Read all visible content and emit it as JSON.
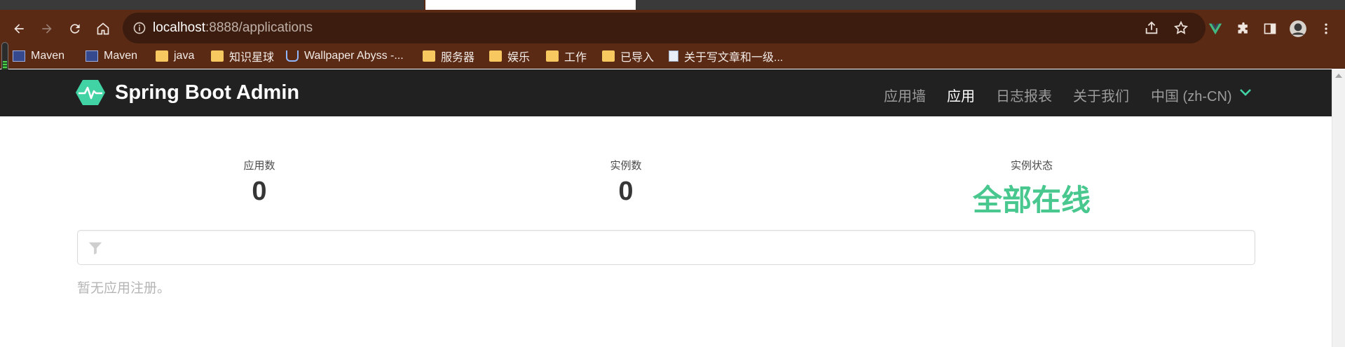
{
  "browser": {
    "url_host": "localhost",
    "url_rest": ":8888/applications",
    "bookmarks": [
      {
        "label": "Maven",
        "icon": "maven-icon"
      },
      {
        "label": "Maven",
        "icon": "maven-icon"
      },
      {
        "label": "java",
        "icon": "folder-icon"
      },
      {
        "label": "知识星球",
        "icon": "folder-icon"
      },
      {
        "label": "Wallpaper Abyss -...",
        "icon": "wallpaper-abyss-icon"
      },
      {
        "label": "服务器",
        "icon": "folder-icon"
      },
      {
        "label": "娱乐",
        "icon": "folder-icon"
      },
      {
        "label": "工作",
        "icon": "folder-icon"
      },
      {
        "label": "已导入",
        "icon": "folder-icon"
      },
      {
        "label": "关于写文章和一级...",
        "icon": "document-icon"
      }
    ]
  },
  "app": {
    "brand": "Spring Boot Admin",
    "nav": [
      {
        "label": "应用墙",
        "active": false
      },
      {
        "label": "应用",
        "active": true
      },
      {
        "label": "日志报表",
        "active": false
      },
      {
        "label": "关于我们",
        "active": false
      },
      {
        "label": "中国 (zh-CN)",
        "active": false
      }
    ],
    "stats": [
      {
        "label": "应用数",
        "value": "0"
      },
      {
        "label": "实例数",
        "value": "0"
      },
      {
        "label": "实例状态",
        "value": "全部在线"
      }
    ],
    "empty_message": "暂无应用注册。",
    "accent_color": "#48c78e",
    "navbar_color": "#212121"
  }
}
